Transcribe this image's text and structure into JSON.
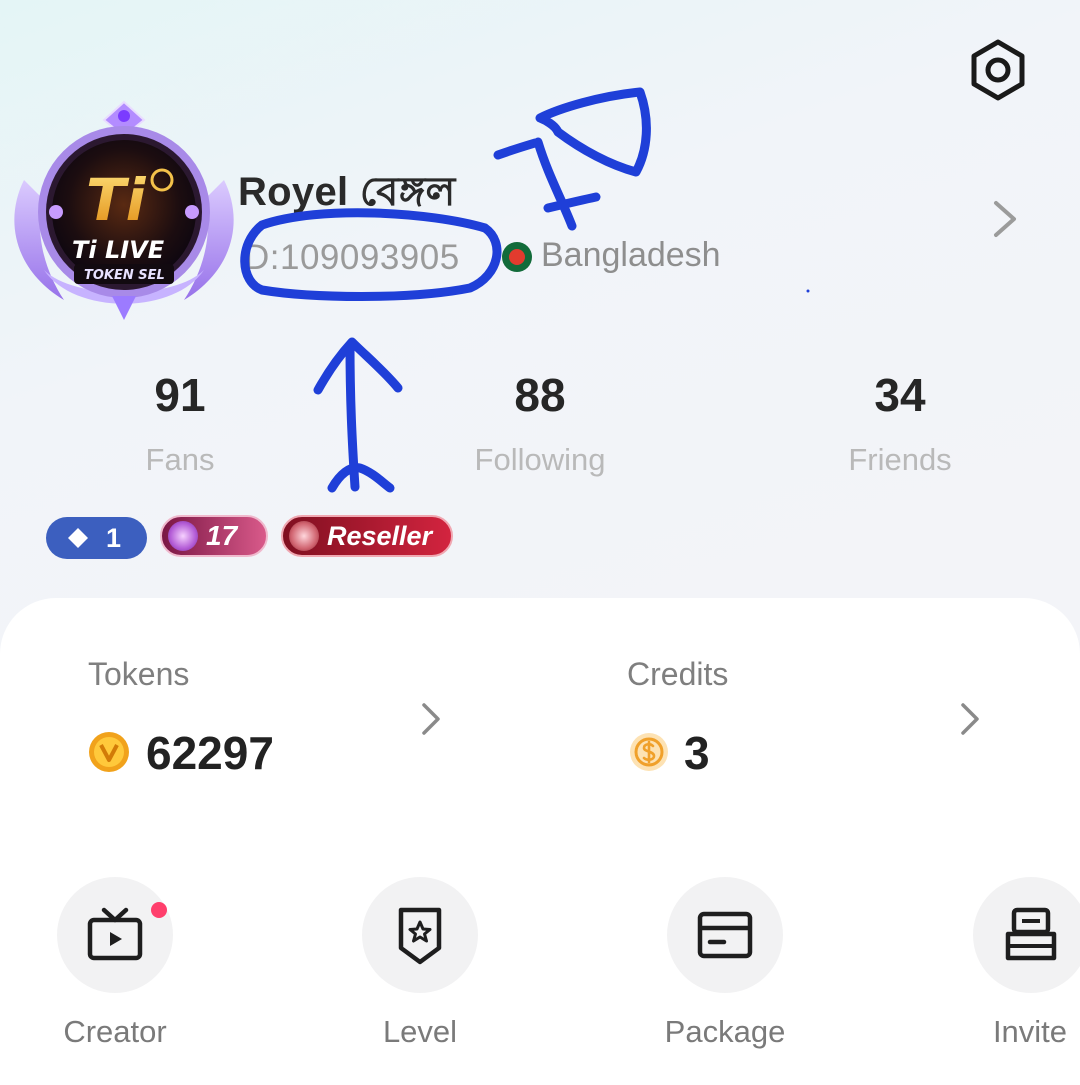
{
  "profile": {
    "name": "Royel বেঙ্গল",
    "id_text": "D:109093905",
    "country": "Bangladesh",
    "avatar_brand": "Ti LIVE",
    "avatar_caption": "TOKEN SEL"
  },
  "stats": [
    {
      "value": "91",
      "label": "Fans"
    },
    {
      "value": "88",
      "label": "Following"
    },
    {
      "value": "34",
      "label": "Friends"
    }
  ],
  "badges": {
    "diamond": "1",
    "level": "17",
    "role": "Reseller"
  },
  "wallet": {
    "tokens_label": "Tokens",
    "tokens_value": "62297",
    "credits_label": "Credits",
    "credits_value": "3"
  },
  "shortcuts": [
    {
      "label": "Creator",
      "icon": "tv-play-icon"
    },
    {
      "label": "Level",
      "icon": "level-shield-icon"
    },
    {
      "label": "Package",
      "icon": "package-card-icon"
    },
    {
      "label": "Invite",
      "icon": "invite-stack-icon"
    }
  ],
  "colors": {
    "annotation_ink": "#1f3fd8",
    "diamond_badge": "#3c5fbf",
    "notification_dot": "#ff3f6c",
    "flag_green": "#126b3a",
    "flag_red": "#e23b2e"
  }
}
